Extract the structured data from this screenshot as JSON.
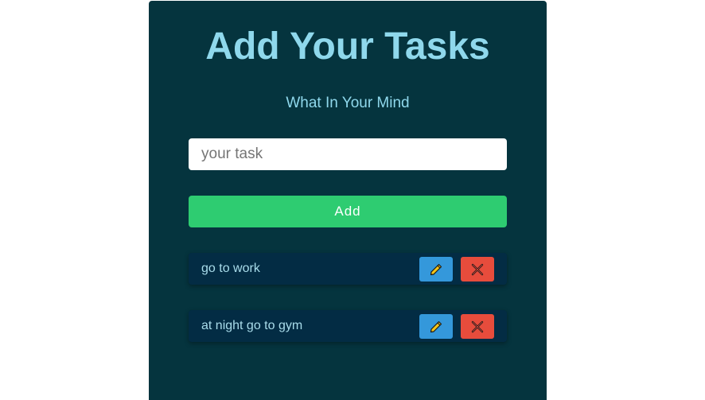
{
  "header": {
    "title": "Add Your Tasks",
    "subtitle": "What In Your Mind"
  },
  "form": {
    "input_placeholder": "your task",
    "input_value": "",
    "add_label": "Add"
  },
  "tasks": [
    {
      "text": "go to work",
      "edit_icon": "pencil-icon",
      "delete_icon": "close-icon"
    },
    {
      "text": "at night go to gym",
      "edit_icon": "pencil-icon",
      "delete_icon": "close-icon"
    }
  ],
  "colors": {
    "page_background": "#ffffff",
    "card_background": "#05343e",
    "heading": "#8fd8ec",
    "add_button": "#2ecc71",
    "task_background": "#032c44",
    "edit_button": "#3498db",
    "delete_button": "#e74c3c",
    "pencil": "#f5c518"
  }
}
